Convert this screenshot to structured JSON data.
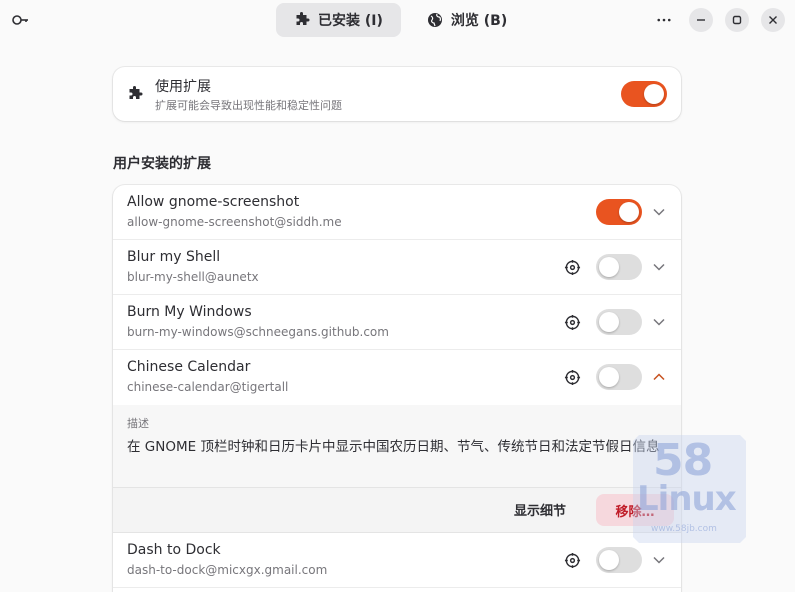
{
  "header": {
    "tabs": [
      {
        "label": "已安装 (I)",
        "icon": "puzzle-icon",
        "active": true
      },
      {
        "label": "浏览 (B)",
        "icon": "globe-icon",
        "active": false
      }
    ]
  },
  "use_extensions": {
    "title": "使用扩展",
    "subtitle": "扩展可能会导致出现性能和稳定性问题",
    "enabled": true
  },
  "section_title": "用户安装的扩展",
  "extensions": [
    {
      "name": "Allow gnome-screenshot",
      "uuid": "allow-gnome-screenshot@siddh.me",
      "enabled": true,
      "has_settings": false,
      "expanded": false
    },
    {
      "name": "Blur my Shell",
      "uuid": "blur-my-shell@aunetx",
      "enabled": false,
      "has_settings": true,
      "expanded": false
    },
    {
      "name": "Burn My Windows",
      "uuid": "burn-my-windows@schneegans.github.com",
      "enabled": false,
      "has_settings": true,
      "expanded": false
    },
    {
      "name": "Chinese Calendar",
      "uuid": "chinese-calendar@tigertall",
      "enabled": false,
      "has_settings": true,
      "expanded": true
    },
    {
      "name": "Dash to Dock",
      "uuid": "dash-to-dock@micxgx.gmail.com",
      "enabled": false,
      "has_settings": true,
      "expanded": false
    }
  ],
  "expanded_details": {
    "desc_label": "描述",
    "desc_text": "在 GNOME 顶栏时钟和日历卡片中显示中国农历日期、节气、传统节日和法定节假日信息",
    "details_button": "显示细节",
    "remove_button": "移除…"
  },
  "watermark": {
    "number": "58",
    "brand": "Linux",
    "url": "www.58jb.com"
  },
  "colors": {
    "accent": "#e95420",
    "destructive": "#c01c28",
    "background": "#fafafa"
  }
}
